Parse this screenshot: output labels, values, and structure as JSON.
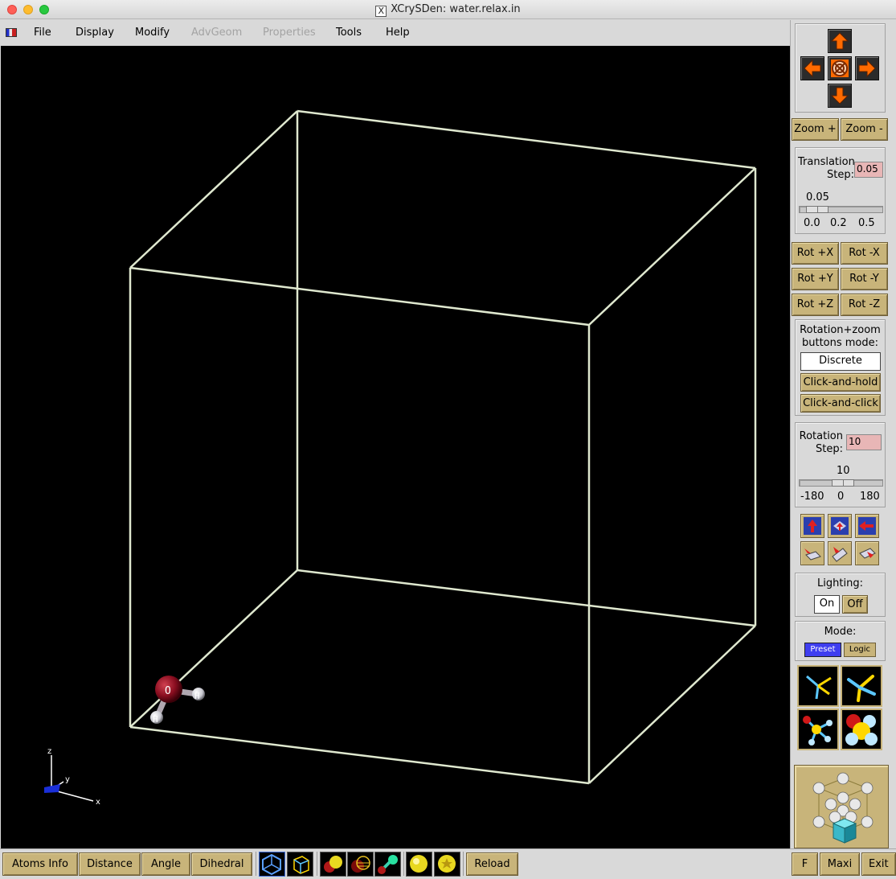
{
  "window": {
    "title": "XCrySDen: water.relax.in",
    "x_logo": "X"
  },
  "menu": [
    {
      "label": "File",
      "disabled": false
    },
    {
      "label": "Display",
      "disabled": false
    },
    {
      "label": "Modify",
      "disabled": false
    },
    {
      "label": "AdvGeom",
      "disabled": true
    },
    {
      "label": "Properties",
      "disabled": true
    },
    {
      "label": "Tools",
      "disabled": false
    },
    {
      "label": "Help",
      "disabled": false
    }
  ],
  "viewport": {
    "background": "#000000",
    "cell_color": "#dfe8cf",
    "atoms": {
      "oxygen": "O",
      "hydrogen1": "H",
      "hydrogen2": "H"
    },
    "axes": {
      "x": "x",
      "y": "y",
      "z": "z"
    }
  },
  "zoom": {
    "plus": "Zoom +",
    "minus": "Zoom -"
  },
  "translation": {
    "label_line1": "Translation",
    "label_line2": "Step:",
    "value": "0.05",
    "slider_value": "0.05",
    "slider_fraction": 0.1,
    "ticks": [
      "0.0",
      "0.2",
      "0.5"
    ]
  },
  "rotate_buttons": [
    "Rot +X",
    "Rot -X",
    "Rot +Y",
    "Rot -Y",
    "Rot +Z",
    "Rot -Z"
  ],
  "rotzoom_mode": {
    "label_line1": "Rotation+zoom",
    "label_line2": "buttons mode:",
    "options": [
      "Discrete",
      "Click-and-hold",
      "Click-and-click"
    ],
    "selected": "Discrete"
  },
  "rotation": {
    "label_line1": "Rotation",
    "label_line2": "Step:",
    "value": "10",
    "slider_value": "10",
    "slider_fraction": 0.53,
    "ticks": [
      "-180",
      "0",
      "180"
    ]
  },
  "lighting": {
    "label": "Lighting:",
    "on": "On",
    "off": "Off",
    "selected": "On"
  },
  "mode": {
    "label": "Mode:",
    "preset": "Preset",
    "logic": "Logic",
    "selected": "Preset"
  },
  "bottom": {
    "atoms_info": "Atoms Info",
    "distance": "Distance",
    "angle": "Angle",
    "dihedral": "Dihedral",
    "reload": "Reload",
    "f": "F",
    "maxi": "Maxi",
    "exit": "Exit"
  },
  "colors": {
    "button_gold": "#c8b47a",
    "entry_pink": "#e8b6b6",
    "preset_blue": "#3f3ef0",
    "arrow_orange": "#ff6a00"
  }
}
